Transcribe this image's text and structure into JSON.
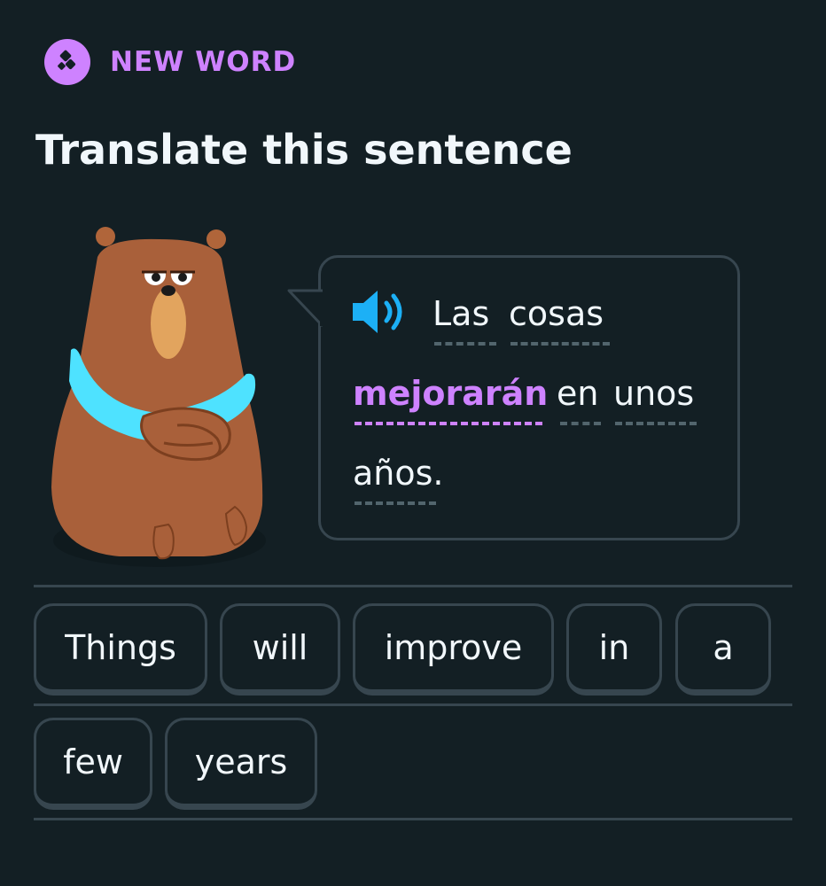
{
  "badge": {
    "label": "NEW WORD",
    "icon": "new-word-icon",
    "color": "#ce82ff"
  },
  "title": "Translate this sentence",
  "prompt": {
    "speaker_icon": "speaker-icon",
    "words": [
      "Las",
      "cosas",
      "mejorarán",
      "en",
      "unos",
      "años."
    ],
    "highlighted_word": "mejorarán"
  },
  "word_bank": [
    "Things",
    "will",
    "improve",
    "in",
    "a",
    "few",
    "years"
  ],
  "colors": {
    "background": "#131f24",
    "border": "#37464f",
    "highlight": "#ce82ff",
    "speaker": "#1cb0f6",
    "text": "#f1f7fb"
  }
}
